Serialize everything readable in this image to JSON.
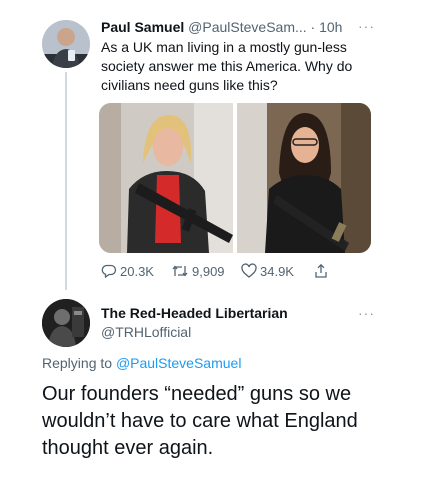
{
  "tweet1": {
    "display_name": "Paul Samuel",
    "handle_truncated": "@PaulSteveSam...",
    "separator": "·",
    "time": "10h",
    "more_label": "···",
    "text": "As a UK man living in a mostly gun-less society answer me this America. Why do civilians need guns like this?",
    "stats": {
      "replies": "20.3K",
      "retweets": "9,909",
      "likes": "34.9K"
    },
    "icons": [
      "reply-icon",
      "retweet-icon",
      "like-icon",
      "share-icon"
    ]
  },
  "tweet2": {
    "display_name": "The Red-Headed Libertarian",
    "handle": "@TRHLofficial",
    "more_label": "···",
    "replying_prefix": "Replying to",
    "replying_mention": "@PaulSteveSamuel",
    "text": "Our founders “needed” guns so we wouldn’t have to care what England thought ever again."
  },
  "colors": {
    "text": "#0f1419",
    "secondary": "#536471",
    "link": "#1d9bf0",
    "thread_line": "#cfd9de"
  }
}
